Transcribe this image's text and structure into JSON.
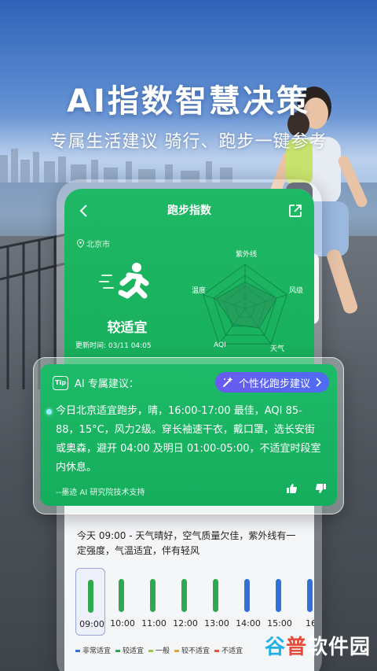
{
  "hero": {
    "title": "AI指数智慧决策",
    "subtitle": "专属生活建议  骑行、跑步一键参考"
  },
  "app": {
    "nav_title": "跑步指数",
    "location": "北京市",
    "rating": "较适宜",
    "updated": "更新时间: 03/11 04:05",
    "radar_labels": {
      "uv": "紫外线",
      "wind": "风级",
      "weather": "天气",
      "aqi": "AQI",
      "temp": "温度"
    },
    "radar_values": [
      0.6,
      0.75,
      0.55,
      0.45,
      0.7
    ]
  },
  "ai_card": {
    "heading": "AI 专属建议：",
    "tip_badge": "Tip",
    "pill_label": "个性化跑步建议",
    "body": "今日北京适宜跑步，晴，16:00-17:00 最佳，AQI 85-88，15°C，风力2级。穿长袖速干衣，戴口罩，选长安街或奥森，避开 04:00 及明日 01:00-05:00，不适宜时段室内休息。",
    "footer": "--墨迹 AI 研究院技术支持"
  },
  "forecast": {
    "text": "今天 09:00 - 天气晴好，空气质量欠佳，紫外线有一定强度，气温适宜，伴有轻风",
    "hours": [
      {
        "time": "09:00",
        "level": "较适宜",
        "color": "#2fa84f",
        "selected": true
      },
      {
        "time": "10:00",
        "level": "较适宜",
        "color": "#2fa84f",
        "selected": false
      },
      {
        "time": "11:00",
        "level": "较适宜",
        "color": "#2fa84f",
        "selected": false
      },
      {
        "time": "12:00",
        "level": "较适宜",
        "color": "#2fa84f",
        "selected": false
      },
      {
        "time": "13:00",
        "level": "较适宜",
        "color": "#2fa84f",
        "selected": false
      },
      {
        "time": "14:00",
        "level": "非常适宜",
        "color": "#2f73d6",
        "selected": false
      },
      {
        "time": "15:00",
        "level": "非常适宜",
        "color": "#2f73d6",
        "selected": false
      },
      {
        "time": "16",
        "level": "非常适宜",
        "color": "#2f73d6",
        "selected": false
      }
    ],
    "legend": [
      {
        "label": "非常适宜",
        "color": "#2f73d6"
      },
      {
        "label": "较适宜",
        "color": "#2fa84f"
      },
      {
        "label": "一般",
        "color": "#9bc94a"
      },
      {
        "label": "较不适宜",
        "color": "#e0a23a"
      },
      {
        "label": "不适宜",
        "color": "#e0563a"
      }
    ]
  },
  "watermark": {
    "text_a": "谷",
    "text_b": "普",
    "text_c": "软件园"
  }
}
